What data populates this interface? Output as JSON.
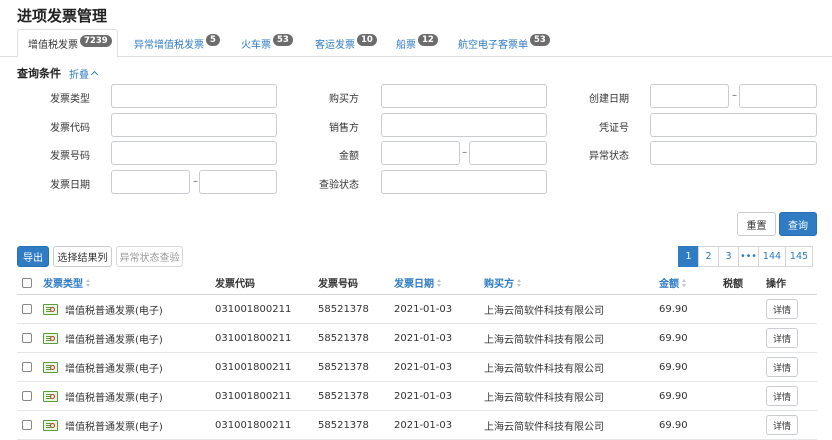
{
  "page": {
    "title": "进项发票管理"
  },
  "tabs": [
    {
      "label": "增值税发票",
      "count": "7239",
      "active": true
    },
    {
      "label": "异常增值税发票",
      "count": "5",
      "active": false
    },
    {
      "label": "火车票",
      "count": "53",
      "active": false
    },
    {
      "label": "客运发票",
      "count": "10",
      "active": false
    },
    {
      "label": "船票",
      "count": "12",
      "active": false
    },
    {
      "label": "航空电子客票单",
      "count": "53",
      "active": false
    }
  ],
  "query": {
    "title": "查询条件",
    "collapse_label": "折叠",
    "fields": {
      "invoice_type": "发票类型",
      "buyer": "购买方",
      "created_date": "创建日期",
      "invoice_code": "发票代码",
      "seller": "销售方",
      "voucher_no": "凭证号",
      "invoice_no": "发票号码",
      "amount": "金额",
      "abnormal_status": "异常状态",
      "invoice_date": "发票日期",
      "verify_status": "查验状态"
    },
    "separator": "–",
    "reset_label": "重置",
    "search_label": "查询"
  },
  "toolbar": {
    "export_label": "导出",
    "select_columns_label": "选择结果列",
    "abnormal_check_label": "异常状态查验"
  },
  "pagination": [
    "1",
    "2",
    "3",
    "•••",
    "144",
    "145"
  ],
  "table": {
    "headers": {
      "invoice_type": "发票类型",
      "invoice_code": "发票代码",
      "invoice_no": "发票号码",
      "invoice_date": "发票日期",
      "buyer": "购买方",
      "amount": "金额",
      "tax": "税额",
      "action": "操作"
    },
    "rows": [
      {
        "type": "增值税普通发票(电子)",
        "code": "031001800211",
        "number": "58521378",
        "date": "2021-01-03",
        "buyer": "上海云简软件科技有限公司",
        "amount": "69.90",
        "tax": "",
        "action": "详情"
      },
      {
        "type": "增值税普通发票(电子)",
        "code": "031001800211",
        "number": "58521378",
        "date": "2021-01-03",
        "buyer": "上海云简软件科技有限公司",
        "amount": "69.90",
        "tax": "",
        "action": "详情"
      },
      {
        "type": "增值税普通发票(电子)",
        "code": "031001800211",
        "number": "58521378",
        "date": "2021-01-03",
        "buyer": "上海云简软件科技有限公司",
        "amount": "69.90",
        "tax": "",
        "action": "详情"
      },
      {
        "type": "增值税普通发票(电子)",
        "code": "031001800211",
        "number": "58521378",
        "date": "2021-01-03",
        "buyer": "上海云简软件科技有限公司",
        "amount": "69.90",
        "tax": "",
        "action": "详情"
      },
      {
        "type": "增值税普通发票(电子)",
        "code": "031001800211",
        "number": "58521378",
        "date": "2021-01-03",
        "buyer": "上海云简软件科技有限公司",
        "amount": "69.90",
        "tax": "",
        "action": "详情"
      }
    ]
  },
  "colors": {
    "accent": "#2f7bc4",
    "badge": "#6c6c6c",
    "border": "#c9cdd2"
  },
  "icons": {
    "invoice": "invoice-icon",
    "collapse": "chevron-up-icon",
    "sort": "sort-icon"
  }
}
